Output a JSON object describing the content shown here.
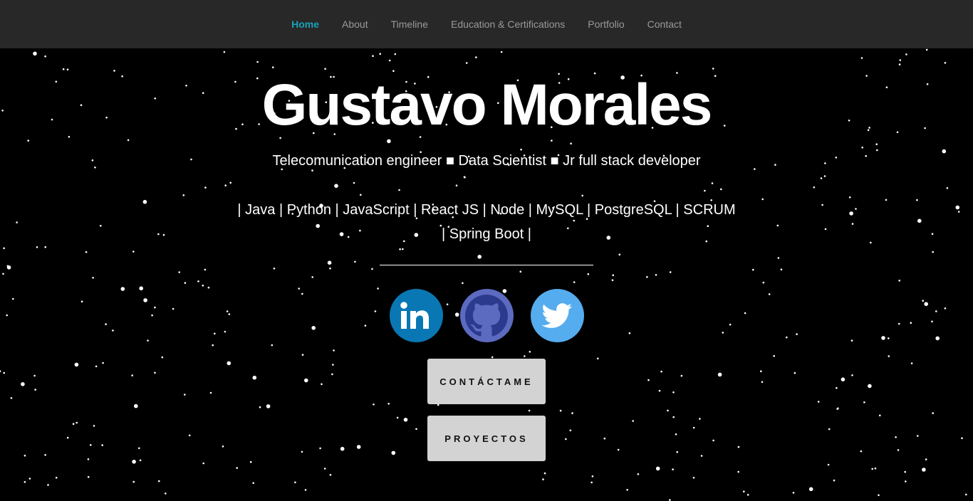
{
  "nav": {
    "items": [
      {
        "label": "Home",
        "active": true
      },
      {
        "label": "About",
        "active": false
      },
      {
        "label": "Timeline",
        "active": false
      },
      {
        "label": "Education & Certifications",
        "active": false
      },
      {
        "label": "Portfolio",
        "active": false
      },
      {
        "label": "Contact",
        "active": false
      }
    ],
    "active_color": "#17a2b8"
  },
  "hero": {
    "name": "Gustavo Morales",
    "tagline": "Telecomunication engineer ■ Data Scientist ■ Jr full stack developer",
    "skills": "| Java | Python | JavaScript | React JS | Node | MySQL | PostgreSQL | SCRUM | Spring Boot |"
  },
  "socials": [
    {
      "name": "linkedin",
      "icon": "linkedin-icon",
      "color": "#0a77b5"
    },
    {
      "name": "github",
      "icon": "github-icon",
      "color": "#5c6bc0"
    },
    {
      "name": "twitter",
      "icon": "twitter-icon",
      "color": "#55acee"
    }
  ],
  "buttons": {
    "contact_label": "CONTÁCTAME",
    "projects_label": "PROYECTOS"
  }
}
